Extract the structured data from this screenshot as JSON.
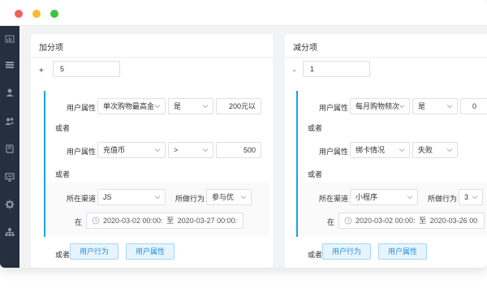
{
  "sidebar": {
    "icons": [
      "dashboard-icon",
      "list-icon",
      "user-icon",
      "users-icon",
      "book-icon",
      "monitor-icon",
      "gear-icon",
      "org-chart-icon"
    ]
  },
  "left_panel": {
    "title": "加分项",
    "sign": "+",
    "score": "5",
    "rule1": {
      "label": "用户属性",
      "attribute": "单次购物最高金",
      "operator": "是",
      "value": "200元以"
    },
    "or1": "或者",
    "rule2": {
      "label": "用户属性",
      "attribute": "充值币",
      "operator": ">",
      "value": "500"
    },
    "or2": "或者",
    "rule3": {
      "channel_label": "所在渠道",
      "channel": "JS",
      "action_label": "所做行为",
      "action": "参与优",
      "time_label": "在",
      "start": "2020-03-02 00:00:",
      "to": "至",
      "end": "2020-03-27 00:00:"
    },
    "footer": {
      "or": "或者",
      "btn_behavior": "用户行为",
      "btn_attribute": "用户属性"
    }
  },
  "right_panel": {
    "title": "减分项",
    "sign": "-",
    "score": "1",
    "rule1": {
      "label": "用户属性",
      "attribute": "每月购物频次",
      "operator": "是",
      "value": "0"
    },
    "or1": "或者",
    "rule2": {
      "label": "用户属性",
      "attribute": "绑卡情况",
      "operator": "失败"
    },
    "or2": "或者",
    "rule3": {
      "channel_label": "所在渠道",
      "channel": "小程序",
      "action_label": "所做行为",
      "action": "3",
      "time_label": "在",
      "start": "2020-03-02 00:00:",
      "to": "至",
      "end": "2020-03-26 00"
    },
    "footer": {
      "or": "或者",
      "btn_behavior": "用户行为",
      "btn_attribute": "用户属性"
    }
  },
  "colors": {
    "accent": "#1f9ee8",
    "sidebar": "#252f3e",
    "button_bg": "#e8f4fd"
  }
}
